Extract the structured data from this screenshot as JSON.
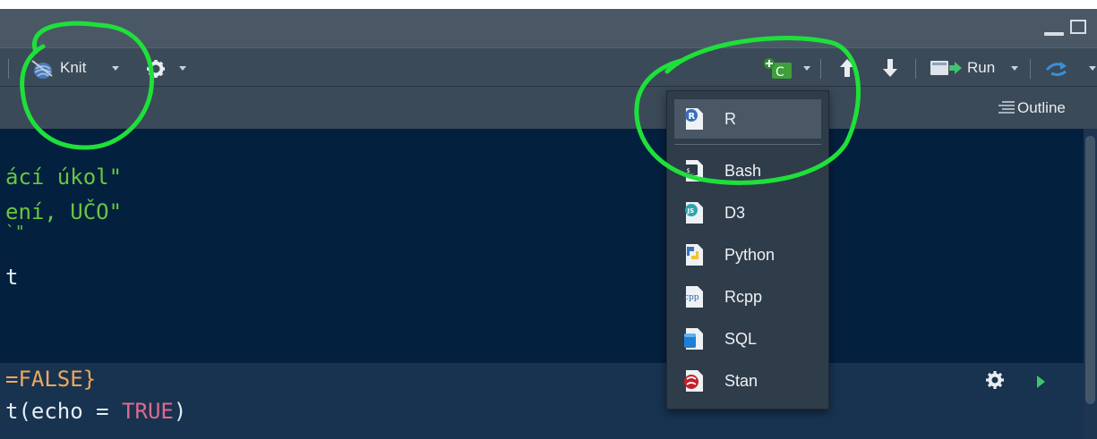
{
  "toolbar": {
    "knit_label": "Knit",
    "run_label": "Run"
  },
  "subbar": {
    "outline_label": "Outline"
  },
  "editor": {
    "lines": [
      "ácí úkol\"",
      "ení, UČO\"",
      "`\"",
      "t"
    ],
    "chunk_header": "=FALSE}",
    "chunk_line_prefix": "t(echo = ",
    "chunk_line_value": "TRUE",
    "chunk_line_suffix": ")"
  },
  "insert_menu": {
    "items": [
      {
        "label": "R",
        "icon": "r-file-icon",
        "highlighted": true
      },
      {
        "label": "Bash",
        "icon": "bash-file-icon"
      },
      {
        "label": "D3",
        "icon": "d3-file-icon"
      },
      {
        "label": "Python",
        "icon": "python-file-icon"
      },
      {
        "label": "Rcpp",
        "icon": "rcpp-file-icon"
      },
      {
        "label": "SQL",
        "icon": "sql-file-icon"
      },
      {
        "label": "Stan",
        "icon": "stan-file-icon"
      }
    ]
  },
  "colors": {
    "toolbar_bg": "#3b4a58",
    "editor_bg": "#03203f",
    "annotation_green": "#1ee03a"
  }
}
